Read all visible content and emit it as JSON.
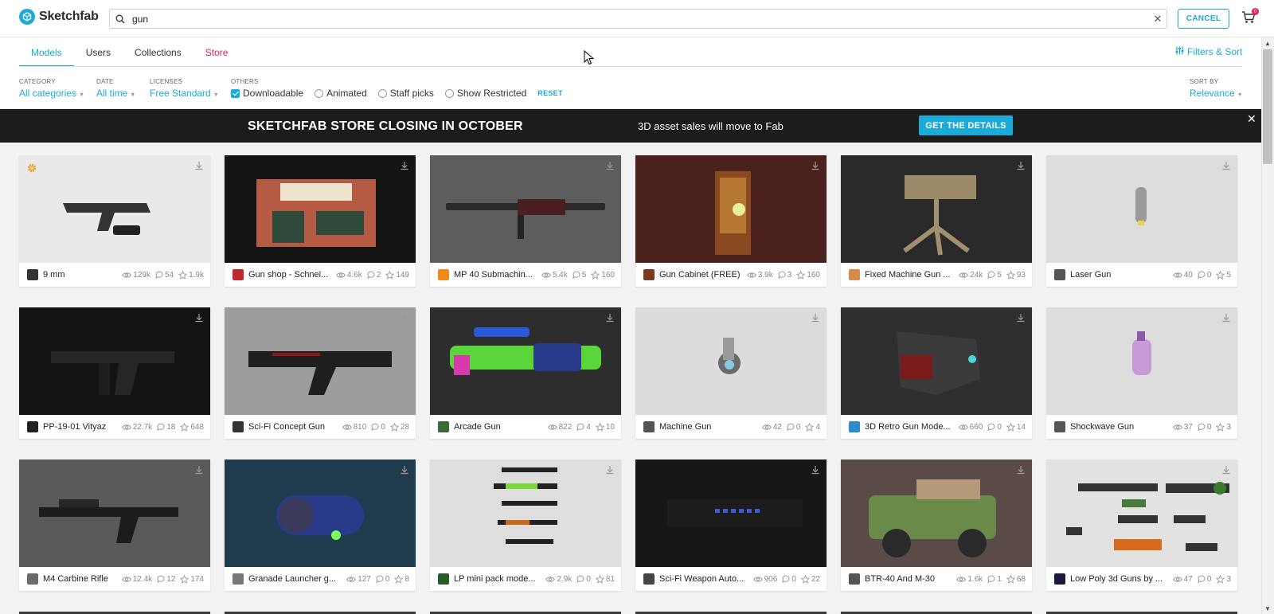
{
  "header": {
    "logo_text": "Sketchfab",
    "search_value": "gun",
    "cancel_label": "CANCEL",
    "cart_count": "0"
  },
  "tabs": [
    {
      "label": "Models",
      "active": true
    },
    {
      "label": "Users"
    },
    {
      "label": "Collections"
    },
    {
      "label": "Store"
    }
  ],
  "filters_sort_label": "Filters & Sort",
  "filters": {
    "category": {
      "label": "CATEGORY",
      "value": "All categories"
    },
    "date": {
      "label": "DATE",
      "value": "All time"
    },
    "licenses": {
      "label": "LICENSES",
      "value": "Free Standard"
    },
    "others": {
      "label": "OTHERS"
    },
    "sort": {
      "label": "SORT BY",
      "value": "Relevance"
    },
    "checkboxes": [
      {
        "label": "Downloadable",
        "checked": true
      },
      {
        "label": "Animated",
        "checked": false
      },
      {
        "label": "Staff picks",
        "checked": false
      },
      {
        "label": "Show Restricted",
        "checked": false
      }
    ],
    "reset_label": "RESET"
  },
  "banner": {
    "title": "SKETCHFAB STORE CLOSING IN OCTOBER",
    "subtitle": "3D asset sales will move to Fab",
    "button": "GET THE DETAILS"
  },
  "models": [
    {
      "title": "9 mm",
      "views": "129k",
      "comments": "54",
      "likes": "1.9k",
      "bg": "#e9e9e9",
      "avatar": "#333",
      "staff": true
    },
    {
      "title": "Gun shop - Schnei...",
      "views": "4.6k",
      "comments": "2",
      "likes": "149",
      "bg": "#141414",
      "avatar": "#c0292c"
    },
    {
      "title": "MP 40 Submachin...",
      "views": "5.4k",
      "comments": "5",
      "likes": "160",
      "bg": "#5d5d5d",
      "avatar": "#f08a1c"
    },
    {
      "title": "Gun Cabinet (FREE)",
      "views": "3.9k",
      "comments": "3",
      "likes": "160",
      "bg": "#4a211d",
      "avatar": "#7a3a22"
    },
    {
      "title": "Fixed Machine Gun ...",
      "views": "24k",
      "comments": "5",
      "likes": "93",
      "bg": "#2a2a2a",
      "avatar": "#d88a4a"
    },
    {
      "title": "Laser Gun",
      "views": "40",
      "comments": "0",
      "likes": "5",
      "bg": "#dddddd",
      "avatar": "#555"
    },
    {
      "title": "PP-19-01 Vityaz",
      "views": "22.7k",
      "comments": "18",
      "likes": "648",
      "bg": "#131313",
      "avatar": "#222"
    },
    {
      "title": "Sci-Fi Concept Gun",
      "views": "810",
      "comments": "0",
      "likes": "28",
      "bg": "#9c9c9c",
      "avatar": "#333"
    },
    {
      "title": "Arcade Gun",
      "views": "822",
      "comments": "4",
      "likes": "10",
      "bg": "#2d2d2d",
      "avatar": "#3a6a3a"
    },
    {
      "title": "Machine Gun",
      "views": "42",
      "comments": "0",
      "likes": "4",
      "bg": "#dcdcdc",
      "avatar": "#555"
    },
    {
      "title": "3D Retro Gun Mode...",
      "views": "660",
      "comments": "0",
      "likes": "14",
      "bg": "#2f2f2f",
      "avatar": "#2b8bcc"
    },
    {
      "title": "Shockwave Gun",
      "views": "37",
      "comments": "0",
      "likes": "3",
      "bg": "#dddddd",
      "avatar": "#555"
    },
    {
      "title": "M4 Carbine Rifle",
      "views": "12.4k",
      "comments": "12",
      "likes": "174",
      "bg": "#5a5a5a",
      "avatar": "#6a6a6a"
    },
    {
      "title": "Granade Launcher g...",
      "views": "127",
      "comments": "0",
      "likes": "8",
      "bg": "#1f3b4d",
      "avatar": "#777"
    },
    {
      "title": "LP mini pack mode...",
      "views": "2.9k",
      "comments": "0",
      "likes": "81",
      "bg": "#dedede",
      "avatar": "#2a5a2a"
    },
    {
      "title": "Sci-Fi Weapon Auto...",
      "views": "906",
      "comments": "0",
      "likes": "22",
      "bg": "#161616",
      "avatar": "#444"
    },
    {
      "title": "BTR-40 And M-30",
      "views": "1.6k",
      "comments": "1",
      "likes": "68",
      "bg": "#5a4a48",
      "avatar": "#555"
    },
    {
      "title": "Low Poly 3d Guns by ...",
      "views": "47",
      "comments": "0",
      "likes": "3",
      "bg": "#e2e2e2",
      "avatar": "#1a1a3a"
    }
  ],
  "colors": {
    "accent": "#1caad9",
    "store": "#e0245e",
    "banner_bg": "#1c1c1c"
  }
}
